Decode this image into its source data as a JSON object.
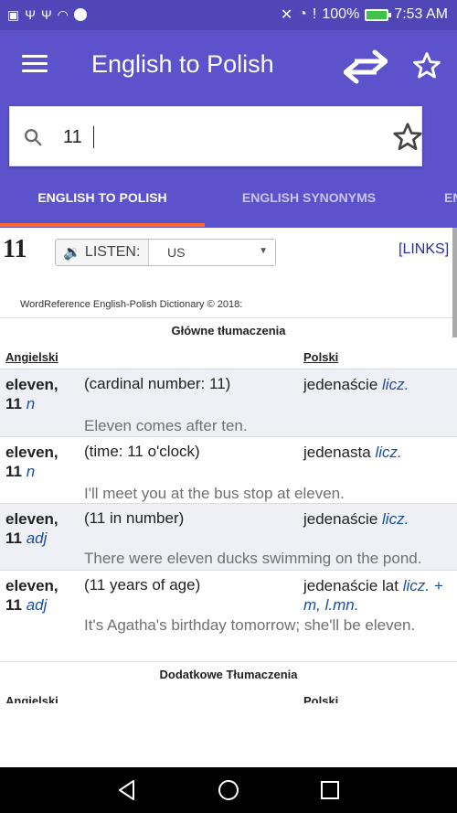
{
  "status_bar": {
    "battery_percent": "100%",
    "time": "7:53 AM"
  },
  "app_bar": {
    "title": "English to Polish",
    "icons": [
      "menu-icon",
      "swap-arrows-icon",
      "star-outline-icon"
    ]
  },
  "search": {
    "value": "11",
    "icon": "search-icon"
  },
  "tabs": [
    {
      "label": "ENGLISH TO POLISH",
      "active": true
    },
    {
      "label": "ENGLISH SYNONYMS",
      "active": false
    },
    {
      "label": "EN",
      "active": false
    }
  ],
  "entry": {
    "headword": "11",
    "listen_label": "LISTEN:",
    "accent": "US",
    "links_label": "[LINKS]",
    "copyright": "WordReference English-Polish Dictionary © 2018:"
  },
  "main_section": {
    "title": "Główne tłumaczenia",
    "col_en": "Angielski",
    "col_pl": "Polski",
    "rows": [
      {
        "hw": "eleven,",
        "hw2": "11",
        "pos": "n",
        "sense": "(cardinal number: 11)",
        "trans": "jedenaście",
        "trans_pos": "licz.",
        "example": "Eleven comes after ten."
      },
      {
        "hw": "eleven,",
        "hw2": "11",
        "pos": "n",
        "sense": "(time: 11 o'clock)",
        "trans": "jedenasta",
        "trans_pos": "licz.",
        "example": "I'll meet you at the bus stop at eleven."
      },
      {
        "hw": "eleven,",
        "hw2": "11",
        "pos": "adj",
        "sense": "(11 in number)",
        "trans": "jedenaście",
        "trans_pos": "licz.",
        "example": "There were eleven ducks swimming on the pond."
      },
      {
        "hw": "eleven,",
        "hw2": "11",
        "pos": "adj",
        "sense": "(11 years of age)",
        "trans": "jedenaście lat",
        "trans_pos": "licz. + m, l.mn.",
        "example": "It's Agatha's birthday tomorrow; she'll be eleven."
      }
    ]
  },
  "additional_section": {
    "title": "Dodatkowe Tłumaczenia",
    "col_en": "Angielski",
    "col_pl": "Polski"
  },
  "colors": {
    "app_bar": "#5c52cc",
    "status_bar": "#4f46b8",
    "tab_indicator": "#ff6a2b",
    "link": "#2a2aa6"
  }
}
